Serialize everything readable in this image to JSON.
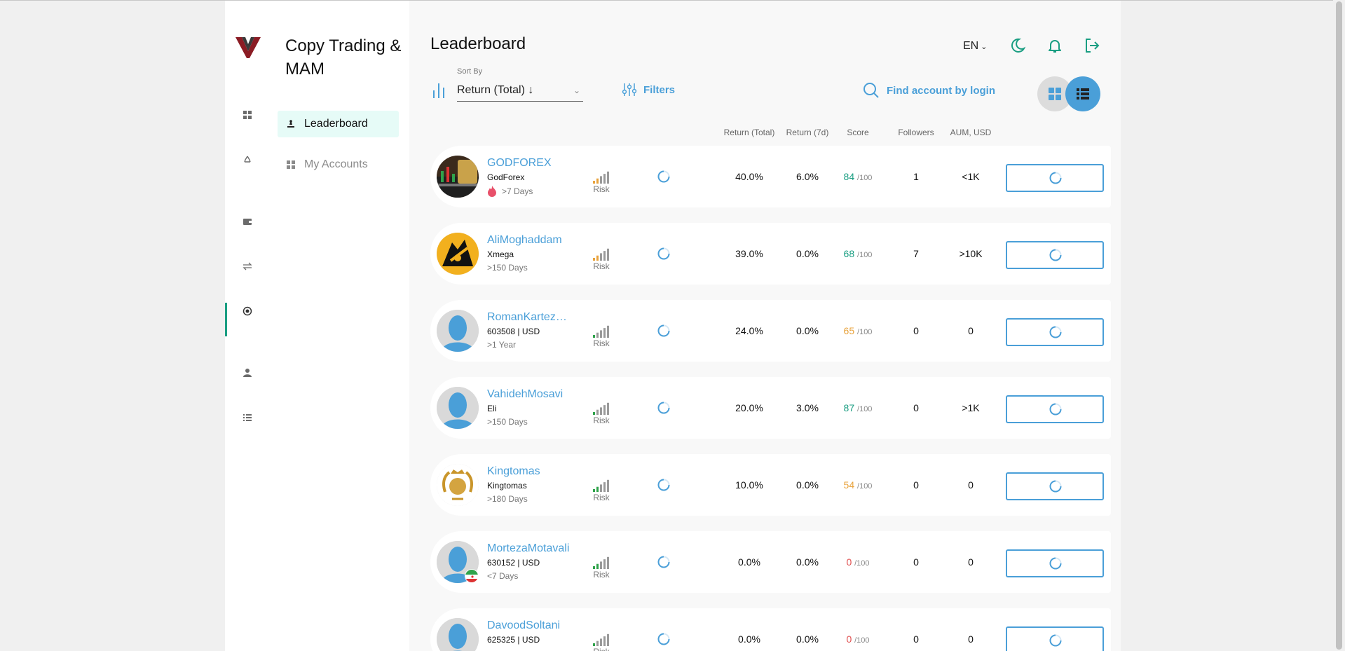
{
  "app": {
    "section_title": "Copy Trading & MAM",
    "nav": [
      {
        "label": "Leaderboard",
        "active": true,
        "icon": "trophy-icon"
      },
      {
        "label": "My Accounts",
        "active": false,
        "icon": "grid-icon"
      }
    ],
    "rail_icons": [
      "dashboard-icon",
      "recycle-icon",
      "wallet-icon",
      "transfer-icon",
      "copy-trading-icon",
      "user-icon",
      "list-icon"
    ]
  },
  "header": {
    "title": "Leaderboard",
    "language": "EN",
    "icons": [
      "moon-icon",
      "bell-icon",
      "logout-icon"
    ]
  },
  "toolbar": {
    "sort_label": "Sort By",
    "sort_value": "Return (Total) ↓",
    "filters_label": "Filters",
    "search_label": "Find account by login"
  },
  "columns": [
    "Return (Total)",
    "Return (7d)",
    "Score",
    "Followers",
    "AUM, USD"
  ],
  "risk_label": "Risk",
  "score_suffix": "/100",
  "colors": {
    "accent": "#1a9e82",
    "link": "#4a9fd8",
    "score_good": "#1a9e82",
    "score_mid": "#e8a33d",
    "score_bad": "#e05050"
  },
  "rows": [
    {
      "name": "GODFOREX",
      "sub": "GodForex",
      "days": ">7 Days",
      "fire": true,
      "avatar": "chart-photo",
      "risk_level": 2,
      "return_total": "40.0%",
      "return_7d": "6.0%",
      "score": "84",
      "score_tier": "good",
      "followers": "1",
      "aum": "<1K"
    },
    {
      "name": "AliMoghaddam",
      "sub": "Xmega",
      "days": ">150 Days",
      "fire": false,
      "avatar": "bull-logo",
      "risk_level": 2,
      "return_total": "39.0%",
      "return_7d": "0.0%",
      "score": "68",
      "score_tier": "good",
      "followers": "7",
      "aum": ">10K"
    },
    {
      "name": "RomanKartezhnikov",
      "sub": "603508 | USD",
      "days": ">1 Year",
      "fire": false,
      "avatar": "default",
      "risk_level": 0,
      "return_total": "24.0%",
      "return_7d": "0.0%",
      "score": "65",
      "score_tier": "mid",
      "followers": "0",
      "aum": "0"
    },
    {
      "name": "VahidehMosavi",
      "sub": "Eli",
      "days": ">150 Days",
      "fire": false,
      "avatar": "default",
      "risk_level": 0,
      "return_total": "20.0%",
      "return_7d": "3.0%",
      "score": "87",
      "score_tier": "good",
      "followers": "0",
      "aum": ">1K"
    },
    {
      "name": "Kingtomas",
      "sub": "Kingtomas",
      "days": ">180 Days",
      "fire": false,
      "avatar": "gold-crest",
      "risk_level": 1,
      "return_total": "10.0%",
      "return_7d": "0.0%",
      "score": "54",
      "score_tier": "mid",
      "followers": "0",
      "aum": "0"
    },
    {
      "name": "MortezaMotavali",
      "sub": "630152 | USD",
      "days": "<7 Days",
      "fire": false,
      "avatar": "default",
      "flag": "iran-flag",
      "risk_level": 1,
      "return_total": "0.0%",
      "return_7d": "0.0%",
      "score": "0",
      "score_tier": "bad",
      "followers": "0",
      "aum": "0"
    },
    {
      "name": "DavoodSoltani",
      "sub": "625325 | USD",
      "days": "",
      "fire": false,
      "avatar": "default",
      "risk_level": 0,
      "return_total": "0.0%",
      "return_7d": "0.0%",
      "score": "0",
      "score_tier": "bad",
      "followers": "0",
      "aum": "0"
    }
  ]
}
